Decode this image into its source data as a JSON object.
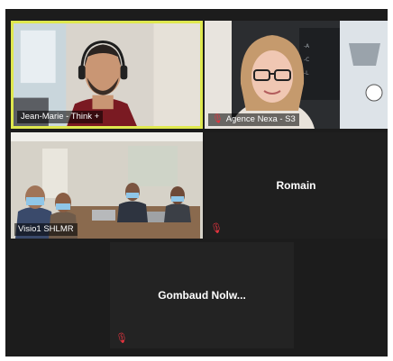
{
  "meeting": {
    "accent_color": "#dfe84e",
    "muted_color": "#e3343f",
    "participants": [
      {
        "display_name": "Jean-Marie - Think +",
        "video": true,
        "speaking": true,
        "muted": false
      },
      {
        "display_name": "Agence Nexa - S3",
        "video": true,
        "speaking": false,
        "muted": true
      },
      {
        "display_name": "Visio1 SHLMR",
        "video": true,
        "speaking": false,
        "muted": false
      },
      {
        "display_name": "Romain",
        "video": false,
        "speaking": false,
        "muted": true
      },
      {
        "display_name": "Gombaud  Nolw...",
        "video": false,
        "speaking": false,
        "muted": true
      }
    ]
  }
}
